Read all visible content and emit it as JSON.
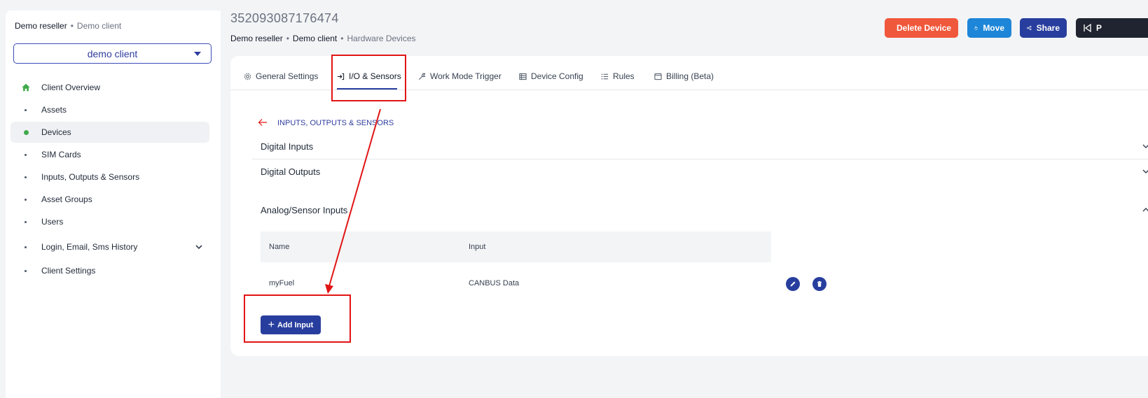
{
  "sidebar": {
    "breadcrumb": {
      "reseller": "Demo reseller",
      "client": "Demo client"
    },
    "client_select": {
      "value": "demo client"
    },
    "items": [
      {
        "label": "Client Overview",
        "icon": "home-icon"
      },
      {
        "label": "Assets"
      },
      {
        "label": "Devices",
        "active": true
      },
      {
        "label": "SIM Cards"
      },
      {
        "label": "Inputs, Outputs & Sensors"
      },
      {
        "label": "Asset Groups"
      },
      {
        "label": "Users"
      },
      {
        "label": "Login, Email, Sms History",
        "expandable": true
      },
      {
        "label": "Client Settings"
      }
    ]
  },
  "header": {
    "device_id": "352093087176474",
    "breadcrumb": {
      "reseller": "Demo reseller",
      "client": "Demo client",
      "current": "Hardware Devices"
    },
    "buttons": {
      "delete": "Delete Device",
      "move": "Move",
      "share": "Share",
      "extra": "P"
    }
  },
  "tabs": [
    {
      "label": "General Settings",
      "icon": "gear-icon"
    },
    {
      "label": "I/O & Sensors",
      "icon": "sign-in-icon",
      "active": true
    },
    {
      "label": "Work Mode Trigger",
      "icon": "wrench-icon"
    },
    {
      "label": "Device Config",
      "icon": "table-icon"
    },
    {
      "label": "Rules",
      "icon": "list-icon"
    },
    {
      "label": "Billing (Beta)",
      "icon": "calendar-icon"
    }
  ],
  "io": {
    "section_title": "INPUTS, OUTPUTS & SENSORS",
    "accordions": {
      "digital_inputs": "Digital Inputs",
      "digital_outputs": "Digital Outputs",
      "analog_inputs": "Analog/Sensor Inputs"
    },
    "table": {
      "headers": {
        "name": "Name",
        "input": "Input"
      },
      "rows": [
        {
          "name": "myFuel",
          "input": "CANBUS Data"
        }
      ]
    },
    "add_button": "Add Input"
  },
  "colors": {
    "primary": "#283e9e",
    "danger": "#f0583c",
    "move": "#1d86d8",
    "annotation": "#e11515",
    "active_dot": "#3faa4b"
  }
}
